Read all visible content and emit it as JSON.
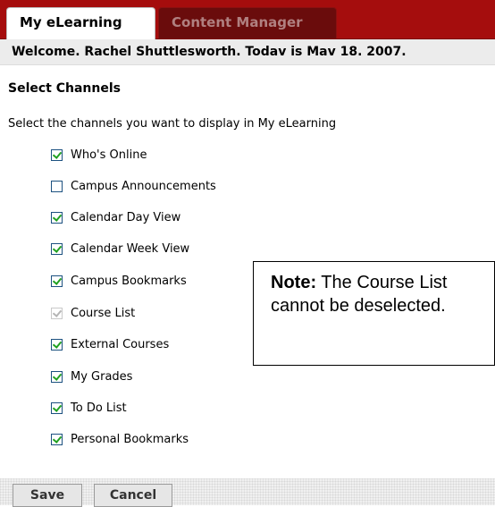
{
  "tabs": [
    {
      "label": "My eLearning",
      "active": true
    },
    {
      "label": "Content Manager",
      "active": false
    }
  ],
  "welcome": "Welcome. Rachel Shuttlesworth. Todav is Mav 18. 2007.",
  "section_title": "Select Channels",
  "instructions": "Select the channels you want to display in My eLearning",
  "channels": [
    {
      "label": "Who's Online",
      "checked": true,
      "disabled": false
    },
    {
      "label": "Campus Announcements",
      "checked": false,
      "disabled": false
    },
    {
      "label": "Calendar Day View",
      "checked": true,
      "disabled": false
    },
    {
      "label": "Calendar Week View",
      "checked": true,
      "disabled": false
    },
    {
      "label": "Campus Bookmarks",
      "checked": true,
      "disabled": false
    },
    {
      "label": "Course List",
      "checked": true,
      "disabled": true
    },
    {
      "label": "External Courses",
      "checked": true,
      "disabled": false
    },
    {
      "label": "My Grades",
      "checked": true,
      "disabled": false
    },
    {
      "label": "To Do List",
      "checked": true,
      "disabled": false
    },
    {
      "label": "Personal Bookmarks",
      "checked": true,
      "disabled": false
    }
  ],
  "note": {
    "bold": "Note:",
    "text": " The Course List  cannot be deselected."
  },
  "buttons": {
    "save": "Save",
    "cancel": "Cancel"
  },
  "colors": {
    "tab_bar": "#a50d0d",
    "check": "#21a121",
    "checkbox_border": "#1c5180"
  }
}
